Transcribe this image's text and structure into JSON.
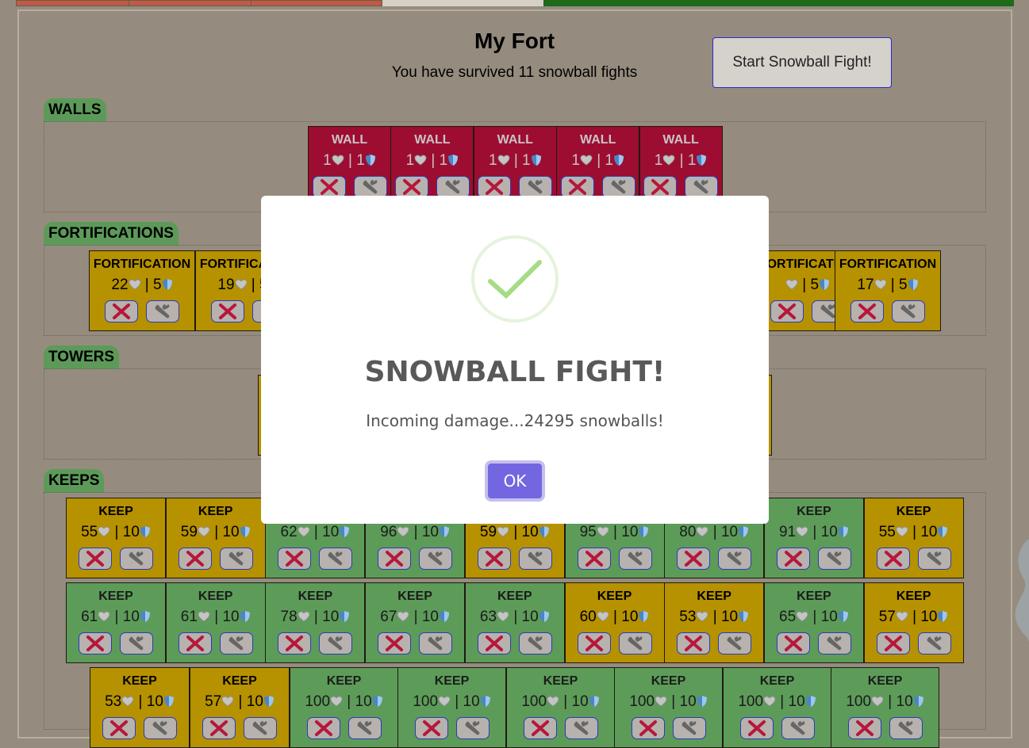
{
  "fort": {
    "title": "My Fort",
    "subtitle": "You have survived 11 snowball fights",
    "start_button": "Start Snowball Fight!"
  },
  "sections": {
    "walls": "WALLS",
    "fortifications": "FORTIFICATIONS",
    "towers": "TOWERS",
    "keeps": "KEEPS"
  },
  "walls": [
    {
      "name": "WALL",
      "health": "1",
      "defense": "1"
    },
    {
      "name": "WALL",
      "health": "1",
      "defense": "1"
    },
    {
      "name": "WALL",
      "health": "1",
      "defense": "1"
    },
    {
      "name": "WALL",
      "health": "1",
      "defense": "1"
    },
    {
      "name": "WALL",
      "health": "1",
      "defense": "1"
    }
  ],
  "fortifications": [
    {
      "name": "FORTIFICATION",
      "health": "22",
      "defense": "5"
    },
    {
      "name": "FORTIFICATION",
      "health": "19",
      "defense": "5"
    },
    {
      "name": "FORTIFICATION",
      "health": "",
      "defense": "5"
    },
    {
      "name": "FORTIFICATION",
      "health": "17",
      "defense": "5"
    }
  ],
  "keeps": [
    {
      "name": "KEEP",
      "health": "55",
      "defense": "10",
      "color": "gold"
    },
    {
      "name": "KEEP",
      "health": "59",
      "defense": "10",
      "color": "gold"
    },
    {
      "name": "KEEP",
      "health": "62",
      "defense": "10",
      "color": "green"
    },
    {
      "name": "KEEP",
      "health": "96",
      "defense": "10",
      "color": "green"
    },
    {
      "name": "KEEP",
      "health": "59",
      "defense": "10",
      "color": "gold"
    },
    {
      "name": "KEEP",
      "health": "95",
      "defense": "10",
      "color": "green"
    },
    {
      "name": "KEEP",
      "health": "80",
      "defense": "10",
      "color": "green"
    },
    {
      "name": "KEEP",
      "health": "91",
      "defense": "10",
      "color": "green"
    },
    {
      "name": "KEEP",
      "health": "55",
      "defense": "10",
      "color": "gold"
    },
    {
      "name": "KEEP",
      "health": "61",
      "defense": "10",
      "color": "green"
    },
    {
      "name": "KEEP",
      "health": "61",
      "defense": "10",
      "color": "green"
    },
    {
      "name": "KEEP",
      "health": "78",
      "defense": "10",
      "color": "green"
    },
    {
      "name": "KEEP",
      "health": "67",
      "defense": "10",
      "color": "green"
    },
    {
      "name": "KEEP",
      "health": "63",
      "defense": "10",
      "color": "green"
    },
    {
      "name": "KEEP",
      "health": "60",
      "defense": "10",
      "color": "gold"
    },
    {
      "name": "KEEP",
      "health": "53",
      "defense": "10",
      "color": "gold"
    },
    {
      "name": "KEEP",
      "health": "65",
      "defense": "10",
      "color": "green"
    },
    {
      "name": "KEEP",
      "health": "57",
      "defense": "10",
      "color": "gold"
    },
    {
      "name": "KEEP",
      "health": "53",
      "defense": "10",
      "color": "gold"
    },
    {
      "name": "KEEP",
      "health": "57",
      "defense": "10",
      "color": "gold"
    },
    {
      "name": "KEEP",
      "health": "100",
      "defense": "10",
      "color": "green"
    },
    {
      "name": "KEEP",
      "health": "100",
      "defense": "10",
      "color": "green"
    },
    {
      "name": "KEEP",
      "health": "100",
      "defense": "10",
      "color": "green"
    },
    {
      "name": "KEEP",
      "health": "100",
      "defense": "10",
      "color": "green"
    },
    {
      "name": "KEEP",
      "health": "100",
      "defense": "10",
      "color": "green"
    },
    {
      "name": "KEEP",
      "health": "100",
      "defense": "10",
      "color": "green"
    }
  ],
  "modal": {
    "title": "SNOWBALL FIGHT!",
    "text": "Incoming damage...24295 snowballs!",
    "ok_label": "OK",
    "icon": "success-check-icon"
  },
  "colors": {
    "wall": "#9d0d32",
    "gold": "#b69100",
    "green": "#5d9b59",
    "accent": "#7267e0",
    "background": "#958c7f"
  }
}
